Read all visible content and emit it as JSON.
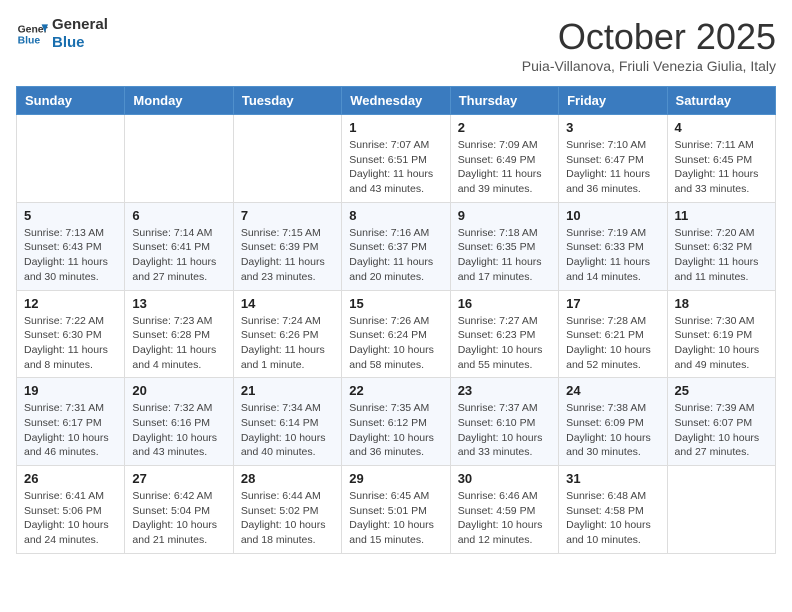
{
  "logo": {
    "line1": "General",
    "line2": "Blue"
  },
  "title": "October 2025",
  "location": "Puia-Villanova, Friuli Venezia Giulia, Italy",
  "days_of_week": [
    "Sunday",
    "Monday",
    "Tuesday",
    "Wednesday",
    "Thursday",
    "Friday",
    "Saturday"
  ],
  "weeks": [
    [
      {
        "day": "",
        "info": ""
      },
      {
        "day": "",
        "info": ""
      },
      {
        "day": "",
        "info": ""
      },
      {
        "day": "1",
        "info": "Sunrise: 7:07 AM\nSunset: 6:51 PM\nDaylight: 11 hours and 43 minutes."
      },
      {
        "day": "2",
        "info": "Sunrise: 7:09 AM\nSunset: 6:49 PM\nDaylight: 11 hours and 39 minutes."
      },
      {
        "day": "3",
        "info": "Sunrise: 7:10 AM\nSunset: 6:47 PM\nDaylight: 11 hours and 36 minutes."
      },
      {
        "day": "4",
        "info": "Sunrise: 7:11 AM\nSunset: 6:45 PM\nDaylight: 11 hours and 33 minutes."
      }
    ],
    [
      {
        "day": "5",
        "info": "Sunrise: 7:13 AM\nSunset: 6:43 PM\nDaylight: 11 hours and 30 minutes."
      },
      {
        "day": "6",
        "info": "Sunrise: 7:14 AM\nSunset: 6:41 PM\nDaylight: 11 hours and 27 minutes."
      },
      {
        "day": "7",
        "info": "Sunrise: 7:15 AM\nSunset: 6:39 PM\nDaylight: 11 hours and 23 minutes."
      },
      {
        "day": "8",
        "info": "Sunrise: 7:16 AM\nSunset: 6:37 PM\nDaylight: 11 hours and 20 minutes."
      },
      {
        "day": "9",
        "info": "Sunrise: 7:18 AM\nSunset: 6:35 PM\nDaylight: 11 hours and 17 minutes."
      },
      {
        "day": "10",
        "info": "Sunrise: 7:19 AM\nSunset: 6:33 PM\nDaylight: 11 hours and 14 minutes."
      },
      {
        "day": "11",
        "info": "Sunrise: 7:20 AM\nSunset: 6:32 PM\nDaylight: 11 hours and 11 minutes."
      }
    ],
    [
      {
        "day": "12",
        "info": "Sunrise: 7:22 AM\nSunset: 6:30 PM\nDaylight: 11 hours and 8 minutes."
      },
      {
        "day": "13",
        "info": "Sunrise: 7:23 AM\nSunset: 6:28 PM\nDaylight: 11 hours and 4 minutes."
      },
      {
        "day": "14",
        "info": "Sunrise: 7:24 AM\nSunset: 6:26 PM\nDaylight: 11 hours and 1 minute."
      },
      {
        "day": "15",
        "info": "Sunrise: 7:26 AM\nSunset: 6:24 PM\nDaylight: 10 hours and 58 minutes."
      },
      {
        "day": "16",
        "info": "Sunrise: 7:27 AM\nSunset: 6:23 PM\nDaylight: 10 hours and 55 minutes."
      },
      {
        "day": "17",
        "info": "Sunrise: 7:28 AM\nSunset: 6:21 PM\nDaylight: 10 hours and 52 minutes."
      },
      {
        "day": "18",
        "info": "Sunrise: 7:30 AM\nSunset: 6:19 PM\nDaylight: 10 hours and 49 minutes."
      }
    ],
    [
      {
        "day": "19",
        "info": "Sunrise: 7:31 AM\nSunset: 6:17 PM\nDaylight: 10 hours and 46 minutes."
      },
      {
        "day": "20",
        "info": "Sunrise: 7:32 AM\nSunset: 6:16 PM\nDaylight: 10 hours and 43 minutes."
      },
      {
        "day": "21",
        "info": "Sunrise: 7:34 AM\nSunset: 6:14 PM\nDaylight: 10 hours and 40 minutes."
      },
      {
        "day": "22",
        "info": "Sunrise: 7:35 AM\nSunset: 6:12 PM\nDaylight: 10 hours and 36 minutes."
      },
      {
        "day": "23",
        "info": "Sunrise: 7:37 AM\nSunset: 6:10 PM\nDaylight: 10 hours and 33 minutes."
      },
      {
        "day": "24",
        "info": "Sunrise: 7:38 AM\nSunset: 6:09 PM\nDaylight: 10 hours and 30 minutes."
      },
      {
        "day": "25",
        "info": "Sunrise: 7:39 AM\nSunset: 6:07 PM\nDaylight: 10 hours and 27 minutes."
      }
    ],
    [
      {
        "day": "26",
        "info": "Sunrise: 6:41 AM\nSunset: 5:06 PM\nDaylight: 10 hours and 24 minutes."
      },
      {
        "day": "27",
        "info": "Sunrise: 6:42 AM\nSunset: 5:04 PM\nDaylight: 10 hours and 21 minutes."
      },
      {
        "day": "28",
        "info": "Sunrise: 6:44 AM\nSunset: 5:02 PM\nDaylight: 10 hours and 18 minutes."
      },
      {
        "day": "29",
        "info": "Sunrise: 6:45 AM\nSunset: 5:01 PM\nDaylight: 10 hours and 15 minutes."
      },
      {
        "day": "30",
        "info": "Sunrise: 6:46 AM\nSunset: 4:59 PM\nDaylight: 10 hours and 12 minutes."
      },
      {
        "day": "31",
        "info": "Sunrise: 6:48 AM\nSunset: 4:58 PM\nDaylight: 10 hours and 10 minutes."
      },
      {
        "day": "",
        "info": ""
      }
    ]
  ]
}
